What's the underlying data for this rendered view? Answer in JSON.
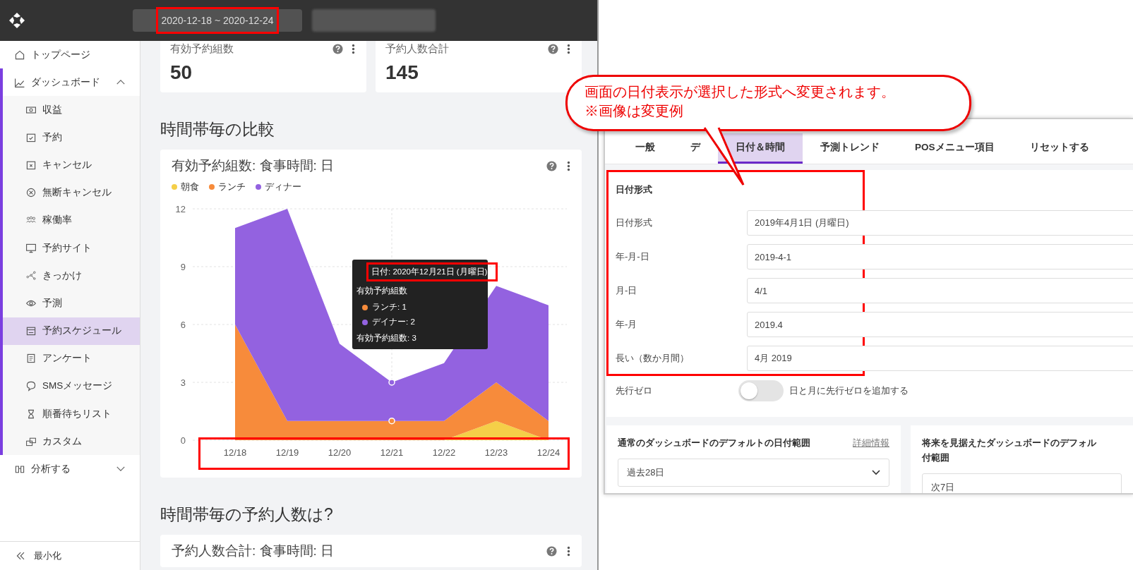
{
  "top_bar": {
    "date_range": "2020-12-18 ~ 2020-12-24"
  },
  "sidebar": {
    "items": [
      {
        "label": "トップページ",
        "selected": false
      },
      {
        "label": "ダッシュボード",
        "expanded": true,
        "children": [
          {
            "label": "収益",
            "selected": false
          },
          {
            "label": "予約",
            "selected": false
          },
          {
            "label": "キャンセル",
            "selected": false
          },
          {
            "label": "無断キャンセル",
            "selected": false
          },
          {
            "label": "稼働率",
            "selected": false
          },
          {
            "label": "予約サイト",
            "selected": false
          },
          {
            "label": "きっかけ",
            "selected": false
          },
          {
            "label": "予測",
            "selected": false
          },
          {
            "label": "予約スケジュール",
            "selected": true
          },
          {
            "label": "アンケート",
            "selected": false
          },
          {
            "label": "SMSメッセージ",
            "selected": false
          },
          {
            "label": "順番待ちリスト",
            "selected": false
          },
          {
            "label": "カスタム",
            "selected": false
          }
        ]
      },
      {
        "label": "分析する",
        "expanded": false
      }
    ],
    "footer": "最小化"
  },
  "kpi_cards": [
    {
      "title": "有効予約組数",
      "value": "50"
    },
    {
      "title": "予約人数合計",
      "value": "145"
    }
  ],
  "sections": [
    {
      "heading": "時間帯毎の比較",
      "card": {
        "title": "有効予約組数: 食事時間: 日",
        "chart_data": {
          "type": "area",
          "stacked": true,
          "grid": true,
          "categories": [
            "12/18",
            "12/19",
            "12/20",
            "12/21",
            "12/22",
            "12/23",
            "12/24"
          ],
          "ylim": [
            0,
            12
          ],
          "yticks": [
            0,
            3,
            6,
            9,
            12
          ],
          "series": [
            {
              "name": "朝食",
              "color": "#f5cf48",
              "values": [
                0,
                0,
                0,
                0,
                0,
                1,
                0
              ]
            },
            {
              "name": "ランチ",
              "color": "#f78b3b",
              "values": [
                6,
                1,
                1,
                1,
                1,
                2,
                1
              ]
            },
            {
              "name": "ディナー",
              "color": "#9362e0",
              "values": [
                5,
                11,
                4,
                2,
                3,
                5,
                6
              ]
            }
          ]
        },
        "tooltip": {
          "date": "日付: 2020年12月21日 (月曜日)",
          "metric": "有効予約組数",
          "items": [
            {
              "label": "ランチ: 1",
              "color": "#f78b3b"
            },
            {
              "label": "デイナー: 2",
              "color": "#9362e0"
            }
          ],
          "total": "有効予約組数: 3"
        }
      }
    },
    {
      "heading": "時間帯毎の予約人数は?",
      "card": {
        "title": "予約人数合計: 食事時間: 日"
      }
    }
  ],
  "settings_panel": {
    "tabs": [
      {
        "label": "一般",
        "selected": false
      },
      {
        "label": "デ",
        "selected": false
      },
      {
        "label": "日付＆時間",
        "selected": true
      },
      {
        "label": "予測トレンド",
        "selected": false
      },
      {
        "label": "POSメニュー項目",
        "selected": false
      },
      {
        "label": "リセットする",
        "selected": false
      }
    ],
    "section_title": "日付形式",
    "fields": [
      {
        "label": "日付形式",
        "value": "2019年4月1日 (月曜日)"
      },
      {
        "label": "年-月-日",
        "value": "2019-4-1"
      },
      {
        "label": "月-日",
        "value": "4/1"
      },
      {
        "label": "年-月",
        "value": "2019.4"
      },
      {
        "label": "長い（数か月間）",
        "value": "4月 2019"
      }
    ],
    "toggle": {
      "label": "先行ゼロ",
      "on": false,
      "description": "日と月に先行ゼロを追加する"
    },
    "range_cards": [
      {
        "title_lines": [
          "通常のダッシュボードのデフォルトの日付範囲"
        ],
        "link": "詳細情報",
        "value": "過去28日"
      },
      {
        "title_lines": [
          "将来を見据えたダッシュボードのデフォル",
          "付範囲"
        ],
        "value": "次7日"
      }
    ]
  },
  "callout": {
    "lines": [
      "画面の日付表示が選択した形式へ変更されます。",
      "※画像は変更例"
    ]
  }
}
